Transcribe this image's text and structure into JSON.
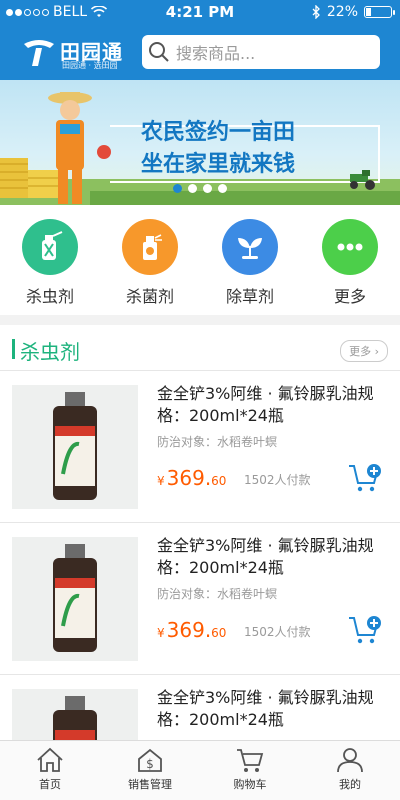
{
  "status_bar": {
    "carrier": "BELL",
    "time": "4:21 PM",
    "battery": "22%",
    "battery_level": 0.22
  },
  "header": {
    "brand": "田园通",
    "brand_sub": "田园通 · 选田园",
    "search_placeholder": "搜索商品..."
  },
  "banner": {
    "line1": "农民签约一亩田",
    "line2": "坐在家里就来钱",
    "pages": 4,
    "active_page": 0
  },
  "categories": [
    {
      "label": "杀虫剂",
      "icon": "insecticide-icon",
      "color": "#2fbf8d"
    },
    {
      "label": "杀菌剂",
      "icon": "fungicide-icon",
      "color": "#f7982b"
    },
    {
      "label": "除草剂",
      "icon": "herbicide-icon",
      "color": "#3c8be4"
    },
    {
      "label": "更多",
      "icon": "more-icon",
      "color": "#4ccf4a"
    }
  ],
  "section": {
    "title": "杀虫剂",
    "more": "更多"
  },
  "products": [
    {
      "name": "金全铲3%阿维 · 氟铃脲乳油规格：200ml*24瓶",
      "target": "防治对象：水稻卷叶螟",
      "currency": "¥",
      "price_int": "369.",
      "price_dec": "60",
      "sales": "1502人付款"
    },
    {
      "name": "金全铲3%阿维 · 氟铃脲乳油规格：200ml*24瓶",
      "target": "防治对象：水稻卷叶螟",
      "currency": "¥",
      "price_int": "369.",
      "price_dec": "60",
      "sales": "1502人付款"
    },
    {
      "name": "金全铲3%阿维 · 氟铃脲乳油规格：200ml*24瓶",
      "target": "",
      "currency": "",
      "price_int": "",
      "price_dec": "",
      "sales": ""
    }
  ],
  "tabbar": [
    {
      "label": "首页",
      "icon": "home-icon"
    },
    {
      "label": "销售管理",
      "icon": "sales-icon"
    },
    {
      "label": "购物车",
      "icon": "cart-icon"
    },
    {
      "label": "我的",
      "icon": "user-icon"
    }
  ],
  "colors": {
    "primary": "#1e86d2",
    "accent_green": "#1db37d",
    "price": "#ff5b00"
  }
}
